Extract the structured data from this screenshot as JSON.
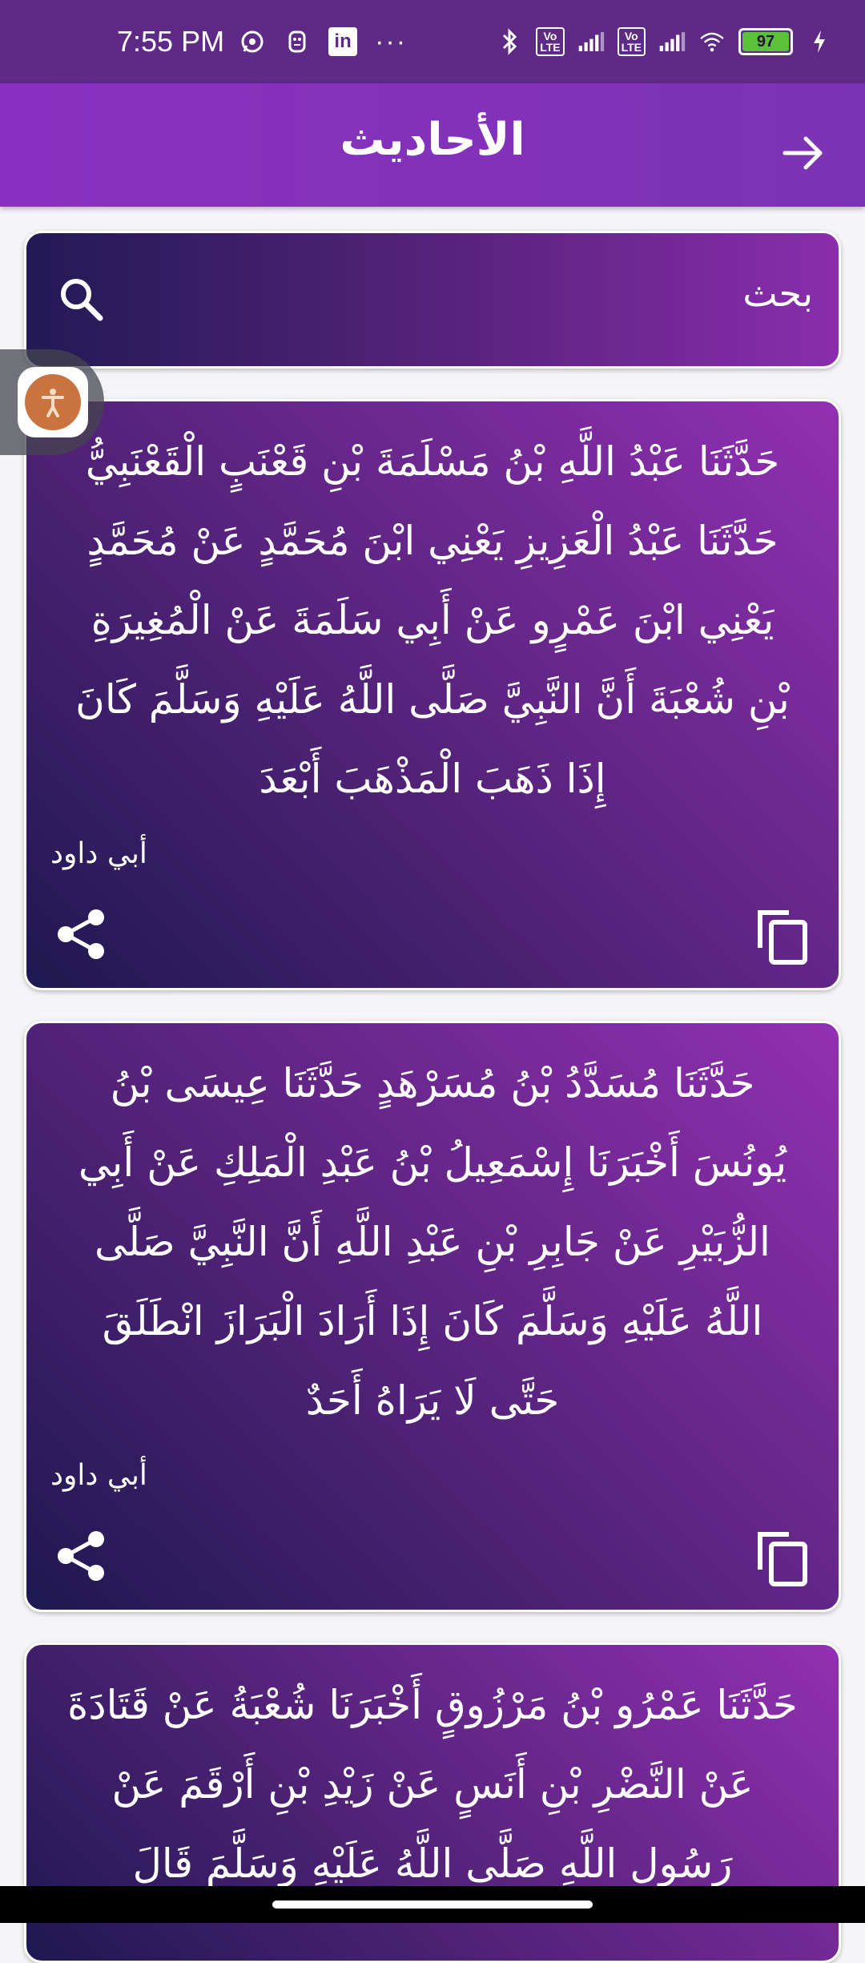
{
  "status_bar": {
    "time": "7:55 PM",
    "left_icons": [
      "whatsapp-icon",
      "app-icon",
      "linkedin-icon"
    ],
    "linkedin_text": "in",
    "dots": "···",
    "volte_1": "Vo\nLTE",
    "volte_2": "Vo\nLTE",
    "battery": "97"
  },
  "app_bar": {
    "title": "الأحاديث",
    "back_icon": "arrow-right-icon"
  },
  "search": {
    "label": "بحث",
    "icon": "search-icon"
  },
  "hadiths": [
    {
      "text": "حَدَّثَنَا  عَبْدُ اللَّهِ بْنُ مَسْلَمَةَ بْنِ قَعْنَبٍ  الْقَعْنَبِيُّ  حَدَّثَنَا  عَبْدُ الْعَزِيزِ يَعْنِي ابْنَ مُحَمَّدٍ  عَنْ  مُحَمَّدٍ يَعْنِي ابْنَ عَمْرٍو  عَنْ  أَبِي سَلَمَةَ  عَنْ  الْمُغِيرَةِ بْنِ شُعْبَةَ  أَنَّ النَّبِيَّ  صَلَّى اللَّهُ عَلَيْهِ وَسَلَّمَ  كَانَ  إِذَا ذَهَبَ الْمَذْهَبَ أَبْعَدَ",
      "source": "أبي داود"
    },
    {
      "text": "حَدَّثَنَا  مُسَدَّدُ بْنُ مُسَرْهَدٍ  حَدَّثَنَا  عِيسَى بْنُ يُونُسَ  أَخْبَرَنَا  إِسْمَعِيلُ بْنُ عَبْدِ الْمَلِكِ  عَنْ  أَبِي الزُّبَيْرِ  عَنْ  جَابِرِ بْنِ عَبْدِ اللَّهِ  أَنَّ النَّبِيَّ  صَلَّى اللَّهُ عَلَيْهِ وَسَلَّمَ  كَانَ  إِذَا أَرَادَ الْبَرَازَ  انْطَلَقَ حَتَّى لَا يَرَاهُ أَحَدٌ",
      "source": "أبي داود"
    },
    {
      "text": "حَدَّثَنَا  عَمْرُو بْنُ مَرْزُوقٍ  أَخْبَرَنَا  شُعْبَةُ  عَنْ  قَتَادَةَ  عَنْ  النَّضْرِ بْنِ أَنَسٍ  عَنْ  زَيْدِ بْنِ أَرْقَمَ  عَنْ رَسُولِ اللَّهِ  صَلَّى اللَّهُ عَلَيْهِ وَسَلَّمَ  قَالَ",
      "source": ""
    }
  ],
  "card_icons": {
    "share": "share-icon",
    "copy": "copy-icon"
  },
  "colors": {
    "status_bar": "#5e2a86",
    "app_bar": "#8a2fc0",
    "card_dark": "#1e1850",
    "card_light": "#9230b3",
    "battery": "#5ac23a"
  }
}
